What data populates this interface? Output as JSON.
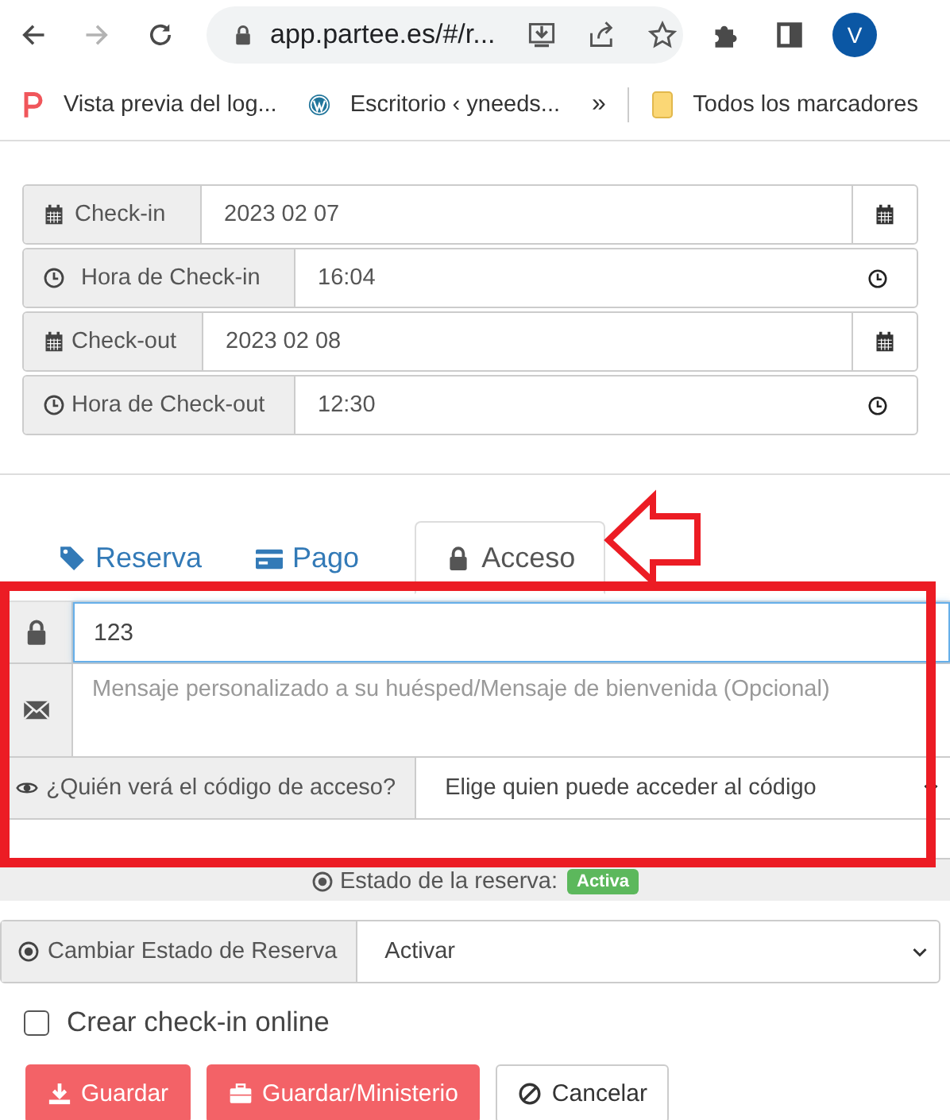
{
  "browser": {
    "url": "app.partee.es/#/r...",
    "avatar": "V",
    "bookmarks": [
      {
        "kind": "p",
        "label": "Vista previa del log..."
      },
      {
        "kind": "wp",
        "label": "Escritorio ‹ yneeds..."
      }
    ],
    "more": "»",
    "folder": "Todos los marcadores"
  },
  "dates": [
    {
      "kind": "date",
      "label": "Check-in",
      "value": "2023 02 07"
    },
    {
      "kind": "time",
      "label": "Hora de Check-in",
      "value": "16:04"
    },
    {
      "kind": "date",
      "label": "Check-out",
      "value": "2023 02 08"
    },
    {
      "kind": "time",
      "label": "Hora de Check-out",
      "value": "12:30"
    }
  ],
  "tabs": [
    {
      "kind": "tag",
      "label": "Reserva",
      "selected": false
    },
    {
      "kind": "card",
      "label": "Pago",
      "selected": false
    },
    {
      "kind": "lock",
      "label": "Acceso",
      "selected": true
    }
  ],
  "access": {
    "code": "123",
    "message_placeholder": "Mensaje personalizado a su huésped/Mensaje de bienvenida (Opcional)",
    "visibility_label": "¿Quién verá el código de acceso?",
    "visibility_value": "Elige quien puede acceder al código"
  },
  "status": {
    "label": "Estado de la reserva:",
    "badge": "Activa"
  },
  "change_status": {
    "label": "Cambiar Estado de Reserva",
    "value": "Activar"
  },
  "online_checkin": {
    "label": "Crear check-in online",
    "checked": false
  },
  "buttons": [
    {
      "kind": "save",
      "label": "Guardar"
    },
    {
      "kind": "ministry",
      "label": "Guardar/Ministerio"
    },
    {
      "kind": "cancel",
      "label": "Cancelar"
    }
  ]
}
